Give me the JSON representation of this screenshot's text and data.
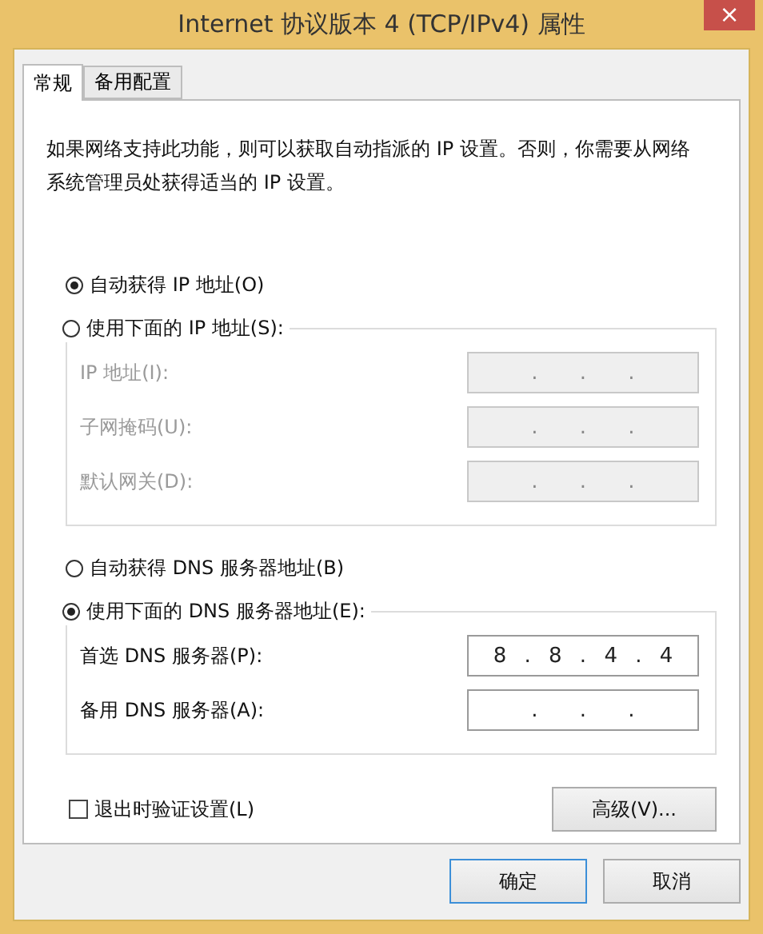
{
  "window": {
    "title": "Internet 协议版本 4 (TCP/IPv4) 属性",
    "close": "×"
  },
  "tabs": [
    {
      "label": "常规",
      "selected": true
    },
    {
      "label": "备用配置",
      "selected": false
    }
  ],
  "description": "如果网络支持此功能，则可以获取自动指派的 IP 设置。否则，你需要从网络系统管理员处获得适当的 IP 设置。",
  "ip_mode": [
    {
      "label": "自动获得 IP 地址(O)",
      "selected": true
    },
    {
      "label": "使用下面的 IP 地址(S):",
      "selected": false
    }
  ],
  "ip_fields": [
    {
      "label": "IP 地址(I):",
      "value": ". . .",
      "disabled": true
    },
    {
      "label": "子网掩码(U):",
      "value": ". . .",
      "disabled": true
    },
    {
      "label": "默认网关(D):",
      "value": ". . .",
      "disabled": true
    }
  ],
  "dns_mode": [
    {
      "label": "自动获得 DNS 服务器地址(B)",
      "selected": false
    },
    {
      "label": "使用下面的 DNS 服务器地址(E):",
      "selected": true
    }
  ],
  "dns_fields": [
    {
      "label": "首选 DNS 服务器(P):",
      "value": "8 . 8 . 4 . 4",
      "disabled": false
    },
    {
      "label": "备用 DNS 服务器(A):",
      "value": ". . .",
      "disabled": false
    }
  ],
  "validate": {
    "label": "退出时验证设置(L)",
    "checked": false
  },
  "advanced_button": "高级(V)...",
  "buttons": [
    {
      "label": "确定",
      "default": true
    },
    {
      "label": "取消",
      "default": false
    }
  ]
}
